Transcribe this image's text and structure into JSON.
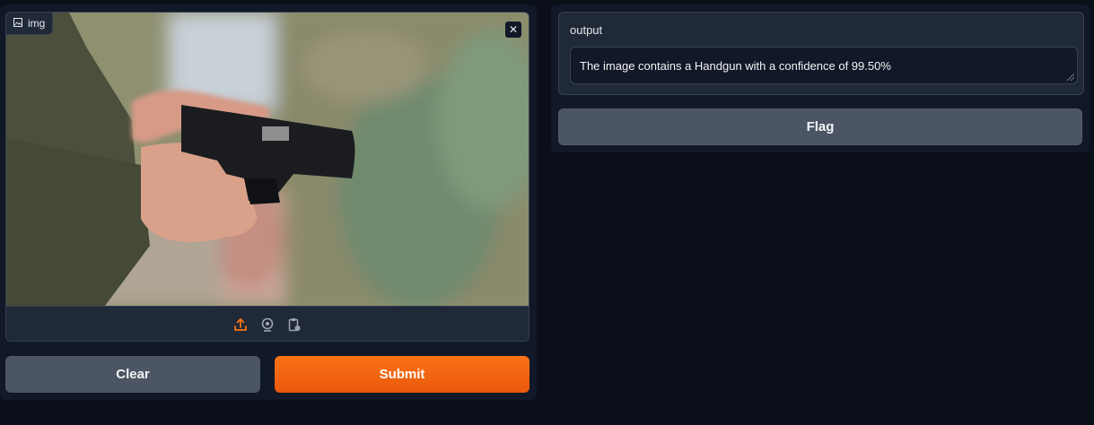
{
  "input": {
    "label": "img",
    "image_alt": "Photo of hands holding a black handgun against a blurred green background"
  },
  "source_icons": [
    "upload-icon",
    "webcam-icon",
    "clipboard-icon"
  ],
  "buttons": {
    "clear": "Clear",
    "submit": "Submit",
    "flag": "Flag"
  },
  "output": {
    "label": "output",
    "value": "The image contains a Handgun with a confidence of 99.50%"
  },
  "colors": {
    "background": "#0b0f19",
    "panel": "#111827",
    "block": "#1f2937",
    "accent": "#f97316",
    "secondary_button": "#4b5563"
  }
}
